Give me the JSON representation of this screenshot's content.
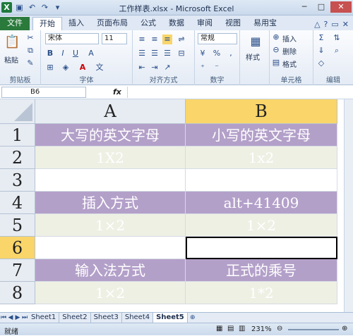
{
  "window": {
    "title": "工作样表.xlsx - Microsoft Excel"
  },
  "tabs": [
    "开始",
    "插入",
    "页面布局",
    "公式",
    "数据",
    "审阅",
    "视图",
    "易用宝"
  ],
  "file_tab": "文件",
  "ribbon": {
    "paste": "粘贴",
    "clipboard": "剪贴板",
    "font_name": "宋体",
    "font_size": "11",
    "font_group": "字体",
    "align_group": "对齐方式",
    "number_format": "常规",
    "number_group": "数字",
    "style": "样式",
    "insert": "插入",
    "delete": "删除",
    "format": "格式",
    "cells_group": "单元格",
    "edit_group": "编辑",
    "font_color_letter": "A",
    "bold": "B",
    "italic": "I",
    "underline": "U"
  },
  "formula_bar": {
    "name_box": "B6",
    "fx": "fx",
    "value": ""
  },
  "columns": [
    "A",
    "B"
  ],
  "rows": [
    {
      "num": "1",
      "a": "大写的英文字母",
      "b": "小写的英文字母",
      "style": "hdrrow"
    },
    {
      "num": "2",
      "a": "1X2",
      "b": "1x2",
      "style": "datarow"
    },
    {
      "num": "3",
      "a": "",
      "b": "",
      "style": "blank"
    },
    {
      "num": "4",
      "a": "插入方式",
      "b": "alt+41409",
      "style": "hdrrow"
    },
    {
      "num": "5",
      "a": "1×2",
      "b": "1×2",
      "style": "datarow"
    },
    {
      "num": "6",
      "a": "",
      "b": "",
      "style": "blank"
    },
    {
      "num": "7",
      "a": "输入法方式",
      "b": "正式的乘号",
      "style": "hdrrow"
    },
    {
      "num": "8",
      "a": "1×2",
      "b": "1*2",
      "style": "datarow"
    }
  ],
  "sheets": [
    "Sheet1",
    "Sheet2",
    "Sheet3",
    "Sheet4",
    "Sheet5"
  ],
  "active_sheet": "Sheet5",
  "status": {
    "mode": "就绪",
    "zoom": "231%"
  },
  "colors": {
    "header_row": "#b3a0c9",
    "data_row": "#eef0e4",
    "selected_header": "#f9d56a"
  }
}
